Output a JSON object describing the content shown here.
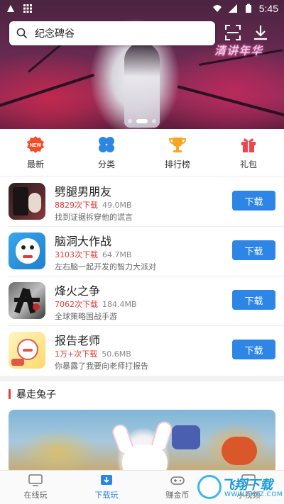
{
  "statusbar": {
    "time": "5:45"
  },
  "search": {
    "query": "纪念碑谷"
  },
  "hero": {
    "overlay_title": "清讲年华"
  },
  "categories": [
    {
      "label": "最新",
      "icon": "new-badge-icon",
      "color": "#f24c2a"
    },
    {
      "label": "分类",
      "icon": "clover-icon",
      "color": "#2d86e6"
    },
    {
      "label": "排行榜",
      "icon": "trophy-icon",
      "color": "#f5a623"
    },
    {
      "label": "礼包",
      "icon": "gift-icon",
      "color": "#f0444d"
    }
  ],
  "apps": [
    {
      "name": "劈腿男朋友",
      "downloads": "8829次下载",
      "size": "49.0MB",
      "desc": "找到证据拆穿他的谎言",
      "button": "下载"
    },
    {
      "name": "脑洞大作战",
      "downloads": "3103次下载",
      "size": "64.7MB",
      "desc": "左右脑一起开发的智力大派对",
      "button": "下载"
    },
    {
      "name": "烽火之争",
      "downloads": "7062次下载",
      "size": "184.4MB",
      "desc": "全球策略国战手游",
      "button": "下载"
    },
    {
      "name": "报告老师",
      "downloads": "1万+次下载",
      "size": "50.6MB",
      "desc": "你暴露了我要向老师打报告",
      "button": "下载"
    }
  ],
  "section": {
    "title": "暴走兔子"
  },
  "bottom_nav": [
    {
      "label": "在线玩",
      "icon": "tv-icon",
      "active": false
    },
    {
      "label": "下载玩",
      "icon": "download-icon",
      "active": true
    },
    {
      "label": "赚金币",
      "icon": "gamepad-icon",
      "active": false
    },
    {
      "label": "小视频",
      "icon": "play-icon",
      "active": false
    }
  ],
  "watermark": {
    "brand": "飞翔下载",
    "url": "WWW.FXXZ.COM"
  },
  "colors": {
    "accent": "#2d86e6",
    "download_count": "#e33a3a",
    "section_bar": "#e33a3a"
  }
}
